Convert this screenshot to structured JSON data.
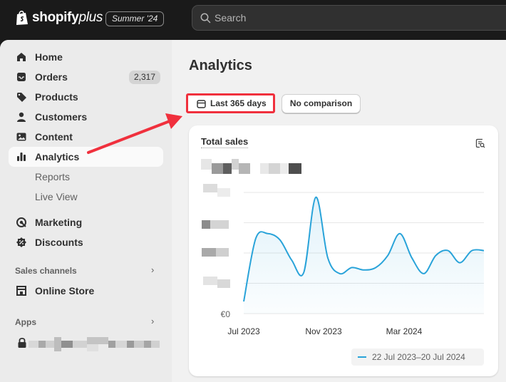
{
  "topbar": {
    "brand_main": "shopify",
    "brand_plus": "plus",
    "edition": "Summer '24",
    "search_placeholder": "Search"
  },
  "sidebar": {
    "items": [
      {
        "label": "Home",
        "icon": "home-icon"
      },
      {
        "label": "Orders",
        "icon": "inbox-icon",
        "badge": "2,317"
      },
      {
        "label": "Products",
        "icon": "tag-icon"
      },
      {
        "label": "Customers",
        "icon": "person-icon"
      },
      {
        "label": "Content",
        "icon": "image-icon"
      },
      {
        "label": "Analytics",
        "icon": "bar-chart-icon",
        "active": true
      }
    ],
    "analytics_sub": [
      "Reports",
      "Live View"
    ],
    "items2": [
      {
        "label": "Marketing",
        "icon": "target-icon"
      },
      {
        "label": "Discounts",
        "icon": "discount-icon"
      }
    ],
    "sales_channels_label": "Sales channels",
    "online_store_label": "Online Store",
    "apps_label": "Apps"
  },
  "main": {
    "title": "Analytics",
    "date_range_button": "Last 365 days",
    "comparison_button": "No comparison",
    "card": {
      "title": "Total sales",
      "legend": "22 Jul 2023–20 Jul 2024"
    }
  },
  "colors": {
    "accent_line": "#29a3d9",
    "annotation": "#f0303d",
    "topbar_bg": "#1a1a1a"
  },
  "chart_data": {
    "type": "line",
    "x_tick_labels": [
      "Jul 2023",
      "Nov 2023",
      "Mar 2024"
    ],
    "y_tick_labels": [
      "€0"
    ],
    "series": [
      {
        "values": [
          0.1,
          0.62,
          0.66,
          0.61,
          0.44,
          0.34,
          0.96,
          0.46,
          0.33,
          0.38,
          0.36,
          0.38,
          0.48,
          0.66,
          0.46,
          0.33,
          0.48,
          0.52,
          0.42,
          0.52,
          0.52
        ]
      }
    ],
    "ylim": [
      0,
      1
    ],
    "grid": true,
    "legend_placement": "bottom-right"
  }
}
